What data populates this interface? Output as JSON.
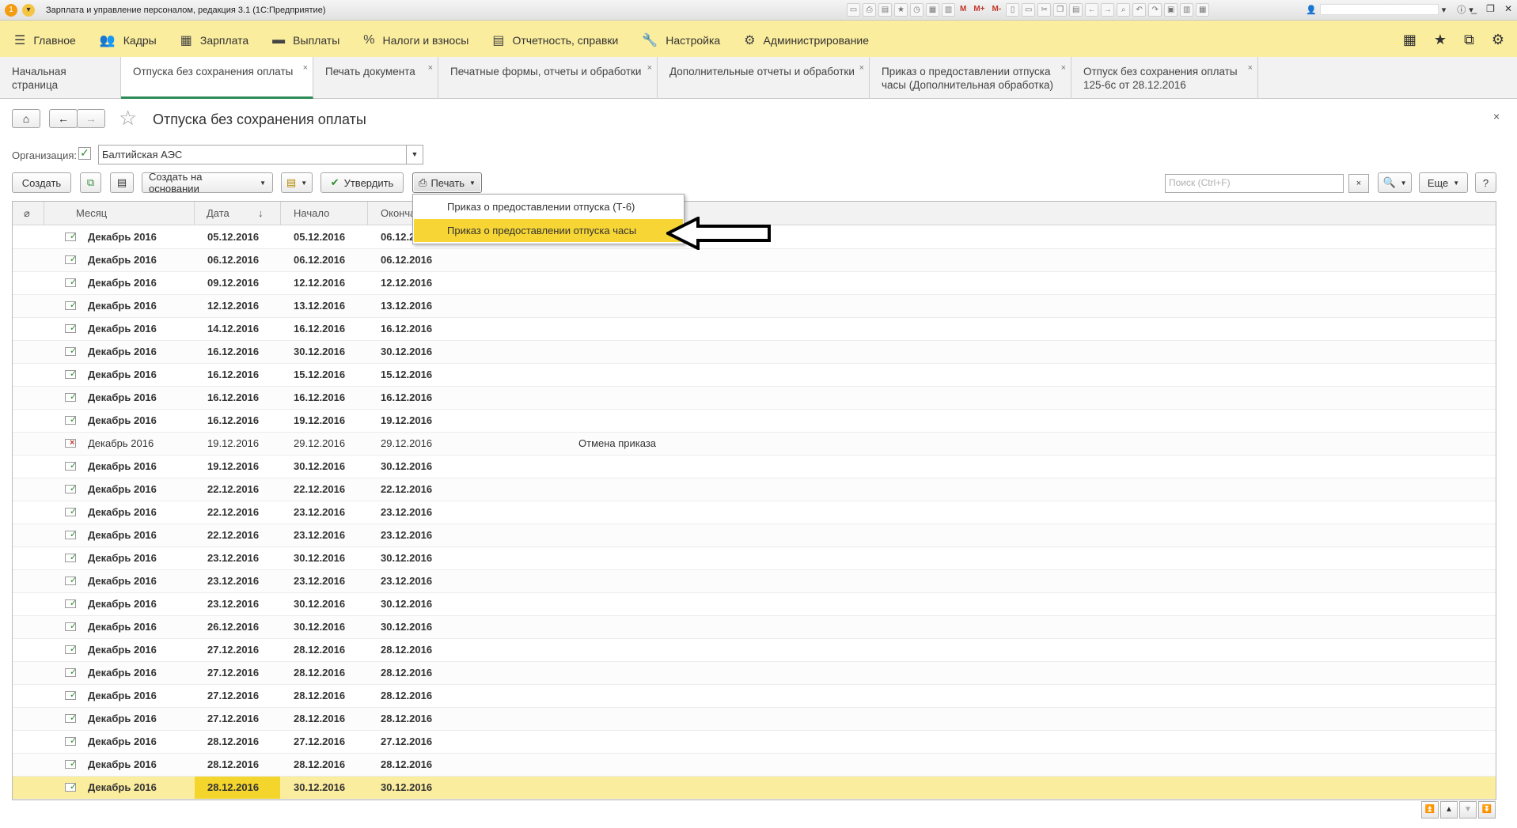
{
  "window": {
    "title": "Зарплата и управление персоналом, редакция 3.1  (1С:Предприятие)",
    "toolbar_letters": [
      "M",
      "M+",
      "M-"
    ]
  },
  "main_menu": [
    {
      "label": "Главное",
      "icon": "hamburger-icon"
    },
    {
      "label": "Кадры",
      "icon": "people-icon"
    },
    {
      "label": "Зарплата",
      "icon": "calculator-icon"
    },
    {
      "label": "Выплаты",
      "icon": "wallet-icon"
    },
    {
      "label": "Налоги и взносы",
      "icon": "percent-icon"
    },
    {
      "label": "Отчетность, справки",
      "icon": "reports-icon"
    },
    {
      "label": "Настройка",
      "icon": "wrench-icon"
    },
    {
      "label": "Администрирование",
      "icon": "gear-icon"
    }
  ],
  "tabs": [
    {
      "label": "Начальная страница",
      "closable": false,
      "active": false
    },
    {
      "label": "Отпуска без сохранения оплаты",
      "closable": true,
      "active": true
    },
    {
      "label": "Печать документа",
      "closable": true,
      "active": false
    },
    {
      "label": "Печатные формы, отчеты и обработки",
      "closable": true,
      "active": false
    },
    {
      "label": "Дополнительные отчеты и обработки",
      "closable": true,
      "active": false
    },
    {
      "label": "Приказ о предоставлении отпуска часы (Дополнительная обработка)",
      "line1": "Приказ о предоставлении отпуска",
      "line2": "часы (Дополнительная обработка)",
      "closable": true,
      "active": false
    },
    {
      "label": "Отпуск без сохранения оплаты 125-6с от 28.12.2016",
      "line1": "Отпуск без сохранения оплаты",
      "line2": "125-6с от 28.12.2016",
      "closable": true,
      "active": false
    }
  ],
  "form": {
    "title": "Отпуска без сохранения оплаты",
    "close": "×",
    "org_label": "Организация:",
    "org_checked": true,
    "org_value": "Балтийская АЭС"
  },
  "commands": {
    "create": "Создать",
    "create_based": "Создать на основании",
    "approve": "Утвердить",
    "print": "Печать",
    "search_placeholder": "Поиск (Ctrl+F)",
    "more": "Еще",
    "help": "?"
  },
  "print_menu": [
    {
      "label": "Приказ о предоставлении отпуска (Т-6)",
      "highlighted": false
    },
    {
      "label": "Приказ о предоставлении отпуска часы",
      "highlighted": true
    }
  ],
  "table": {
    "columns": [
      "Месяц",
      "Дата",
      "Начало",
      "Оконча"
    ],
    "sort_indicator": "↓",
    "rows": [
      {
        "month": "Декабрь 2016",
        "date": "05.12.2016",
        "start": "05.12.2016",
        "end": "06.12.2016",
        "posted": true,
        "comment": ""
      },
      {
        "month": "Декабрь 2016",
        "date": "06.12.2016",
        "start": "06.12.2016",
        "end": "06.12.2016",
        "posted": true,
        "comment": ""
      },
      {
        "month": "Декабрь 2016",
        "date": "09.12.2016",
        "start": "12.12.2016",
        "end": "12.12.2016",
        "posted": true,
        "comment": ""
      },
      {
        "month": "Декабрь 2016",
        "date": "12.12.2016",
        "start": "13.12.2016",
        "end": "13.12.2016",
        "posted": true,
        "comment": ""
      },
      {
        "month": "Декабрь 2016",
        "date": "14.12.2016",
        "start": "16.12.2016",
        "end": "16.12.2016",
        "posted": true,
        "comment": ""
      },
      {
        "month": "Декабрь 2016",
        "date": "16.12.2016",
        "start": "30.12.2016",
        "end": "30.12.2016",
        "posted": true,
        "comment": ""
      },
      {
        "month": "Декабрь 2016",
        "date": "16.12.2016",
        "start": "15.12.2016",
        "end": "15.12.2016",
        "posted": true,
        "comment": ""
      },
      {
        "month": "Декабрь 2016",
        "date": "16.12.2016",
        "start": "16.12.2016",
        "end": "16.12.2016",
        "posted": true,
        "comment": ""
      },
      {
        "month": "Декабрь 2016",
        "date": "16.12.2016",
        "start": "19.12.2016",
        "end": "19.12.2016",
        "posted": true,
        "comment": ""
      },
      {
        "month": "Декабрь 2016",
        "date": "19.12.2016",
        "start": "29.12.2016",
        "end": "29.12.2016",
        "posted": false,
        "comment": "Отмена приказа"
      },
      {
        "month": "Декабрь 2016",
        "date": "19.12.2016",
        "start": "30.12.2016",
        "end": "30.12.2016",
        "posted": true,
        "comment": ""
      },
      {
        "month": "Декабрь 2016",
        "date": "22.12.2016",
        "start": "22.12.2016",
        "end": "22.12.2016",
        "posted": true,
        "comment": ""
      },
      {
        "month": "Декабрь 2016",
        "date": "22.12.2016",
        "start": "23.12.2016",
        "end": "23.12.2016",
        "posted": true,
        "comment": ""
      },
      {
        "month": "Декабрь 2016",
        "date": "22.12.2016",
        "start": "23.12.2016",
        "end": "23.12.2016",
        "posted": true,
        "comment": ""
      },
      {
        "month": "Декабрь 2016",
        "date": "23.12.2016",
        "start": "30.12.2016",
        "end": "30.12.2016",
        "posted": true,
        "comment": ""
      },
      {
        "month": "Декабрь 2016",
        "date": "23.12.2016",
        "start": "23.12.2016",
        "end": "23.12.2016",
        "posted": true,
        "comment": ""
      },
      {
        "month": "Декабрь 2016",
        "date": "23.12.2016",
        "start": "30.12.2016",
        "end": "30.12.2016",
        "posted": true,
        "comment": ""
      },
      {
        "month": "Декабрь 2016",
        "date": "26.12.2016",
        "start": "30.12.2016",
        "end": "30.12.2016",
        "posted": true,
        "comment": ""
      },
      {
        "month": "Декабрь 2016",
        "date": "27.12.2016",
        "start": "28.12.2016",
        "end": "28.12.2016",
        "posted": true,
        "comment": ""
      },
      {
        "month": "Декабрь 2016",
        "date": "27.12.2016",
        "start": "28.12.2016",
        "end": "28.12.2016",
        "posted": true,
        "comment": ""
      },
      {
        "month": "Декабрь 2016",
        "date": "27.12.2016",
        "start": "28.12.2016",
        "end": "28.12.2016",
        "posted": true,
        "comment": ""
      },
      {
        "month": "Декабрь 2016",
        "date": "27.12.2016",
        "start": "28.12.2016",
        "end": "28.12.2016",
        "posted": true,
        "comment": ""
      },
      {
        "month": "Декабрь 2016",
        "date": "28.12.2016",
        "start": "27.12.2016",
        "end": "27.12.2016",
        "posted": true,
        "comment": ""
      },
      {
        "month": "Декабрь 2016",
        "date": "28.12.2016",
        "start": "28.12.2016",
        "end": "28.12.2016",
        "posted": true,
        "comment": ""
      },
      {
        "month": "Декабрь 2016",
        "date": "28.12.2016",
        "start": "30.12.2016",
        "end": "30.12.2016",
        "posted": true,
        "comment": "",
        "selected": true
      }
    ]
  },
  "colors": {
    "menu_bar": "#fbed9e",
    "highlight": "#f6d534",
    "selected_row": "#fbed9e",
    "posted_mark": "#2a8c2a",
    "cancelled_mark": "#c0392b"
  }
}
